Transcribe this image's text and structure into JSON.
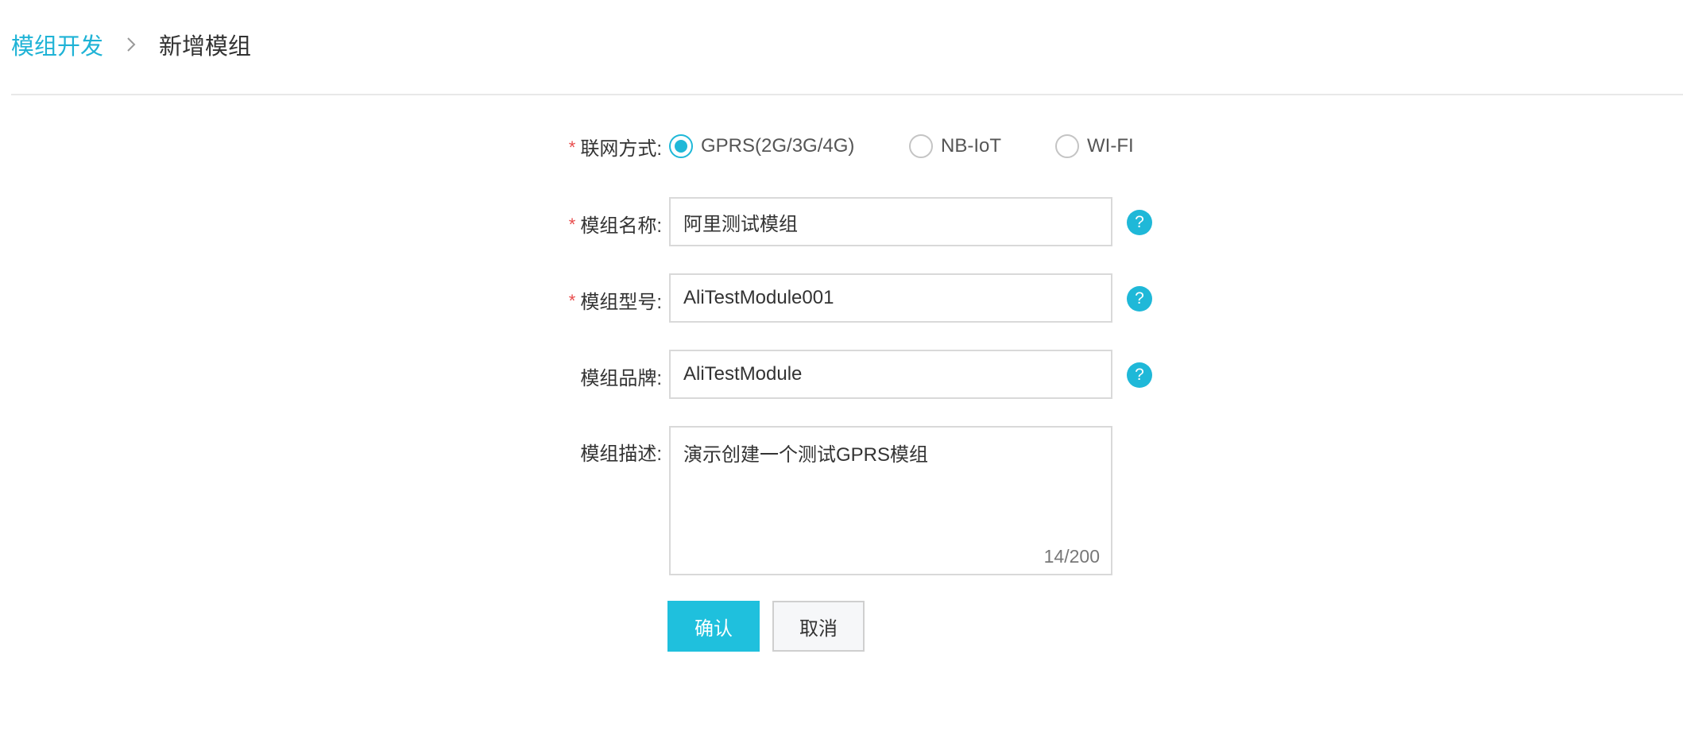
{
  "breadcrumb": {
    "parent": "模组开发",
    "current": "新增模组"
  },
  "form": {
    "network": {
      "label": "联网方式:",
      "required": true,
      "options": [
        "GPRS(2G/3G/4G)",
        "NB-IoT",
        "WI-FI"
      ],
      "selected": "GPRS(2G/3G/4G)"
    },
    "module_name": {
      "label": "模组名称:",
      "required": true,
      "value": "阿里测试模组"
    },
    "module_model": {
      "label": "模组型号:",
      "required": true,
      "value": "AliTestModule001"
    },
    "module_brand": {
      "label": "模组品牌:",
      "required": false,
      "value": "AliTestModule"
    },
    "module_desc": {
      "label": "模组描述:",
      "value": "演示创建一个测试GPRS模组",
      "counter": "14/200"
    },
    "help_glyph": "?",
    "required_mark": "*"
  },
  "actions": {
    "confirm_label": "确认",
    "cancel_label": "取消"
  },
  "colors": {
    "accent": "#1fb8d8",
    "required": "#e84c4c",
    "primary_button": "#1fc0dd"
  }
}
